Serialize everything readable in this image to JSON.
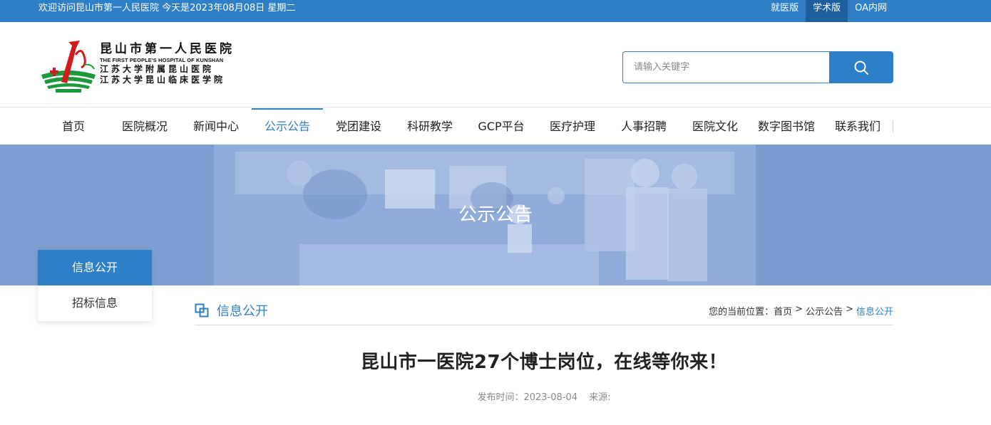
{
  "topbar": {
    "welcome": "欢迎访问昆山市第一人民医院 今天是2023年08月08日 星期二",
    "links": [
      "就医版",
      "学术版",
      "OA内网"
    ]
  },
  "logo": {
    "name_cn": "昆山市第一人民医院",
    "name_en": "THE FIRST PEOPLE'S HOSPITAL OF KUNSHAN",
    "line2": "江苏大学附属昆山医院",
    "line3": "江苏大学昆山临床医学院"
  },
  "search": {
    "placeholder": "请输入关键字"
  },
  "nav": {
    "items": [
      "首页",
      "医院概况",
      "新闻中心",
      "公示公告",
      "党团建设",
      "科研教学",
      "GCP平台",
      "医疗护理",
      "人事招聘",
      "医院文化",
      "数字图书馆",
      "联系我们"
    ],
    "active": "公示公告"
  },
  "banner": {
    "title": "公示公告"
  },
  "sidemenu": {
    "items": [
      "信息公开",
      "招标信息"
    ]
  },
  "section": {
    "title": "信息公开"
  },
  "breadcrumb": {
    "prefix": "您的当前位置：",
    "items": [
      "首页",
      "公示公告",
      "信息公开"
    ],
    "separator": ">"
  },
  "article": {
    "title": "昆山市一医院27个博士岗位，在线等你来！",
    "publish_label": "发布时间：2023-08-04",
    "source_label": "来源:"
  },
  "colors": {
    "primary": "#2d7fc8",
    "primary_dark": "#1d5f9c",
    "banner": "#7f9fd4"
  }
}
